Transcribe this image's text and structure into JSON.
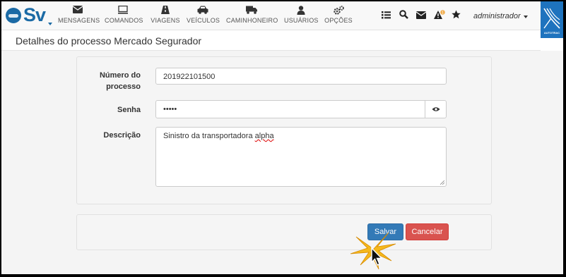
{
  "nav": {
    "logo_text": "Sv",
    "items": [
      {
        "label": "MENSAGENS",
        "icon": "envelope-icon"
      },
      {
        "label": "COMANDOS",
        "icon": "monitor-icon"
      },
      {
        "label": "VIAGENS",
        "icon": "road-icon"
      },
      {
        "label": "VEÍCULOS",
        "icon": "car-icon"
      },
      {
        "label": "CAMINHONEIRO",
        "icon": "truck-icon"
      },
      {
        "label": "USUÁRIOS",
        "icon": "user-icon"
      },
      {
        "label": "OPÇÕES",
        "icon": "gears-icon"
      }
    ],
    "right_icons": [
      "list-icon",
      "search-icon",
      "envelope-icon",
      "alert-icon",
      "star-icon"
    ],
    "alert_badge": "1",
    "user": "administrador",
    "brand_text": "AUTOTRAC"
  },
  "page": {
    "title": "Detalhes do processo Mercado Segurador"
  },
  "form": {
    "process_number_label": "Número do processo",
    "process_number_value": "201922101500",
    "password_label": "Senha",
    "password_value": "•••••",
    "description_label": "Descrição",
    "description_value_a": "Sinistro da transportadora ",
    "description_value_b": "alpha"
  },
  "actions": {
    "save_label": "Salvar",
    "cancel_label": "Cancelar"
  },
  "colors": {
    "primary": "#337ab7",
    "danger": "#d9534f",
    "brand": "#1e73be"
  }
}
